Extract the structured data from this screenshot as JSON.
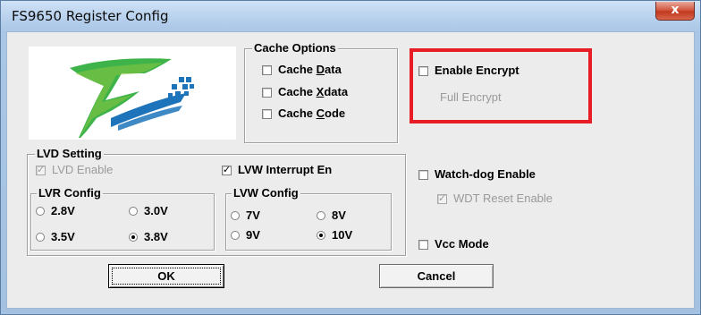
{
  "window": {
    "title": "FS9650 Register Config",
    "close_glyph": "x"
  },
  "logo": {
    "icon": "company-logo"
  },
  "cache_options": {
    "title": "Cache Options",
    "items": [
      {
        "pre": "Cache ",
        "key": "D",
        "post": "ata",
        "checked": false
      },
      {
        "pre": "Cache ",
        "key": "X",
        "post": "data",
        "checked": false
      },
      {
        "pre": "Cache ",
        "key": "C",
        "post": "ode",
        "checked": false
      }
    ]
  },
  "encrypt": {
    "enable_label": "Enable Encrypt",
    "enable_checked": false,
    "full_label": "Full Encrypt",
    "highlight_color": "#e81c24"
  },
  "lvd": {
    "title": "LVD Setting",
    "lvd_enable_label": "LVD Enable",
    "lvd_enable_checked": true,
    "lvw_interrupt_label": "LVW Interrupt En",
    "lvw_interrupt_checked": true
  },
  "lvr_config": {
    "title": "LVR Config",
    "options": [
      "2.8V",
      "3.0V",
      "3.5V",
      "3.8V"
    ],
    "selected": "3.8V"
  },
  "lvw_config": {
    "title": "LVW Config",
    "options": [
      "7V",
      "8V",
      "9V",
      "10V"
    ],
    "selected": "10V"
  },
  "watchdog": {
    "enable_label": "Watch-dog Enable",
    "enable_checked": false,
    "wdt_reset_label": "WDT Reset Enable",
    "wdt_reset_checked": true
  },
  "vcc_mode": {
    "label": "Vcc Mode",
    "checked": false
  },
  "buttons": {
    "ok": "OK",
    "cancel": "Cancel"
  }
}
